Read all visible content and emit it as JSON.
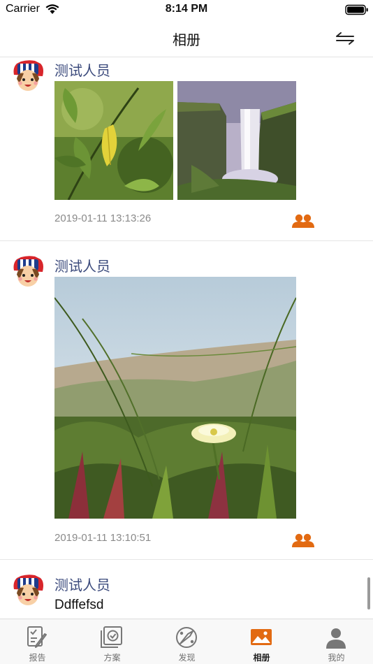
{
  "status_bar": {
    "carrier": "Carrier",
    "time": "8:14 PM"
  },
  "nav": {
    "title": "相册",
    "swap_icon": "swap-arrows-icon"
  },
  "posts": [
    {
      "name": "测试人员",
      "time": "2019-01-11 13:13:26",
      "photos": [
        "leaf-photo",
        "waterfall-photo"
      ]
    },
    {
      "name": "测试人员",
      "time": "2019-01-11 13:10:51",
      "photos": [
        "flower-grass-photo"
      ]
    },
    {
      "name": "测试人员",
      "text": "Ddffefsd"
    }
  ],
  "tabs": [
    {
      "label": "报告",
      "icon": "report-icon"
    },
    {
      "label": "方案",
      "icon": "plan-icon"
    },
    {
      "label": "发现",
      "icon": "discover-icon"
    },
    {
      "label": "相册",
      "icon": "album-icon",
      "active": true
    },
    {
      "label": "我的",
      "icon": "profile-icon"
    }
  ],
  "colors": {
    "accent": "#e26a12",
    "name": "#3b4a7c",
    "time": "#8a8a8a"
  }
}
